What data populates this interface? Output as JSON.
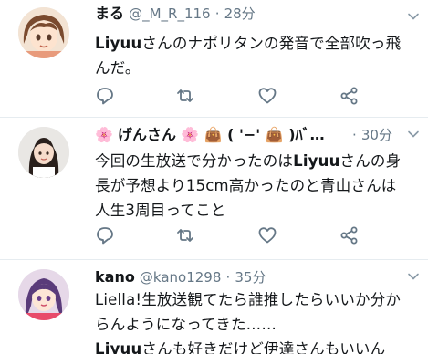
{
  "tweets": [
    {
      "name": "まる",
      "handle": "@_M_R_116",
      "dot": "·",
      "time": "28分",
      "text_parts": [
        {
          "bold": true,
          "text": "Liyuu"
        },
        {
          "bold": false,
          "text": "さんのナポリタンの発音で全部吹っ飛"
        },
        {
          "bold": false,
          "text": "んだ。"
        }
      ]
    },
    {
      "name_prefix": "🌸",
      "name": "げんさん",
      "name_suffix": "🌸 👜 ( '−' 👜 )ﾊﾞ…",
      "dot": "·",
      "time": "30分",
      "text_parts": [
        {
          "bold": false,
          "text": "今回の生放送で分かったのは"
        },
        {
          "bold": true,
          "text": "Liyuu"
        },
        {
          "bold": false,
          "text": "さんの身"
        },
        {
          "bold": false,
          "text": "長が予想より15cm高かったのと青山さんは"
        },
        {
          "bold": false,
          "text": "人生3周目ってこと"
        }
      ]
    },
    {
      "name": "kano",
      "handle": "@kano1298",
      "dot": "·",
      "time": "35分",
      "text_parts": [
        {
          "bold": false,
          "text": "Liella!生放送観てたら誰推したらいいか分か"
        },
        {
          "bold": false,
          "text": "らんようになってきた……"
        },
        {
          "bold": true,
          "text": "Liyuu"
        },
        {
          "bold": false,
          "text": "さんも好きだけど伊達さんもいいん"
        }
      ]
    }
  ],
  "colors": {
    "text": "#14171a",
    "secondary": "#657786",
    "divider": "#e6ecf0"
  },
  "icons": [
    "reply-icon",
    "retweet-icon",
    "like-icon",
    "share-icon",
    "chevron-down-icon"
  ]
}
